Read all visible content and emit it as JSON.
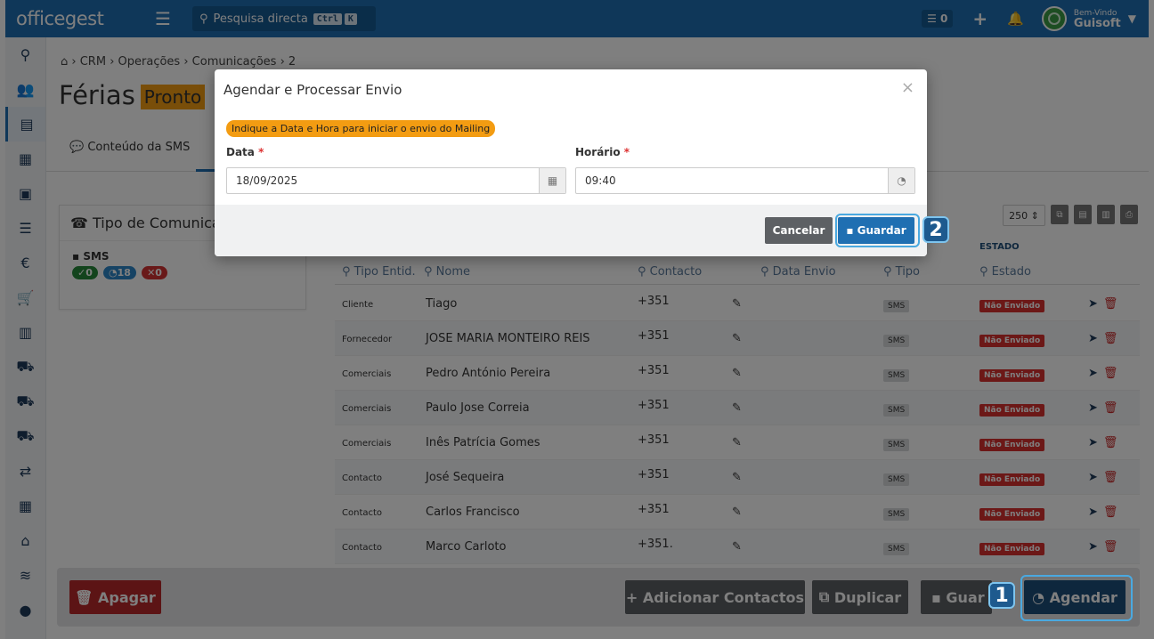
{
  "app": {
    "logo": "officegest",
    "search_label": "Pesquisa directa",
    "search_kbd1": "Ctrl",
    "search_kbd2": "K",
    "tasks_count": "0",
    "welcome": "Bem-Vindo",
    "user": "Guisoft"
  },
  "breadcrumb": [
    "CRM",
    "Operações",
    "Comunicações",
    "2"
  ],
  "page": {
    "title": "Férias",
    "status": "Pronto",
    "tab_sms": "Conteúdo da SMS"
  },
  "left_panel": {
    "title": "Tipo de Comunica",
    "sms_label": "SMS",
    "count_ok": "0",
    "count_pending": "18",
    "count_err": "0"
  },
  "table": {
    "per_page": "250",
    "estado_header": "ESTADO",
    "filters": {
      "tipo": "Tipo Entid.",
      "nome": "Nome",
      "contacto": "Contacto",
      "data": "Data Envio",
      "tipo2": "Tipo",
      "estado": "Estado"
    },
    "rows": [
      {
        "tipo": "Cliente",
        "nome": "Tiago",
        "contacto": "+351",
        "tipo2": "SMS",
        "estado": "Não Enviado"
      },
      {
        "tipo": "Fornecedor",
        "nome": "JOSE MARIA MONTEIRO REIS",
        "contacto": "+351",
        "tipo2": "SMS",
        "estado": "Não Enviado"
      },
      {
        "tipo": "Comerciais",
        "nome": "Pedro António Pereira",
        "contacto": "+351",
        "tipo2": "SMS",
        "estado": "Não Enviado"
      },
      {
        "tipo": "Comerciais",
        "nome": "Paulo Jose Correia",
        "contacto": "+351",
        "tipo2": "SMS",
        "estado": "Não Enviado"
      },
      {
        "tipo": "Comerciais",
        "nome": "Inês Patrícia Gomes",
        "contacto": "+351",
        "tipo2": "SMS",
        "estado": "Não Enviado"
      },
      {
        "tipo": "Contacto",
        "nome": "José Sequeira",
        "contacto": "+351",
        "tipo2": "SMS",
        "estado": "Não Enviado"
      },
      {
        "tipo": "Contacto",
        "nome": "Carlos Francisco",
        "contacto": "+351",
        "tipo2": "SMS",
        "estado": "Não Enviado"
      },
      {
        "tipo": "Contacto",
        "nome": "Marco Carloto",
        "contacto": "+351.",
        "tipo2": "SMS",
        "estado": "Não Enviado"
      }
    ]
  },
  "bottom": {
    "apagar": "Apagar",
    "adicionar": "Adicionar Contactos",
    "duplicar": "Duplicar",
    "guardar": "Guar",
    "agendar": "Agendar",
    "step1": "1"
  },
  "modal": {
    "title": "Agendar e Processar Envio",
    "info": "Indique a Data e Hora para iniciar o envio do Mailing",
    "data_label": "Data",
    "data_value": "18/09/2025",
    "hora_label": "Horário",
    "hora_value": "09:40",
    "cancel": "Cancelar",
    "save": "Guardar",
    "step2": "2"
  },
  "colors": {
    "brand": "#1f6fb2",
    "danger": "#b8282a",
    "warning": "#f39c12"
  }
}
